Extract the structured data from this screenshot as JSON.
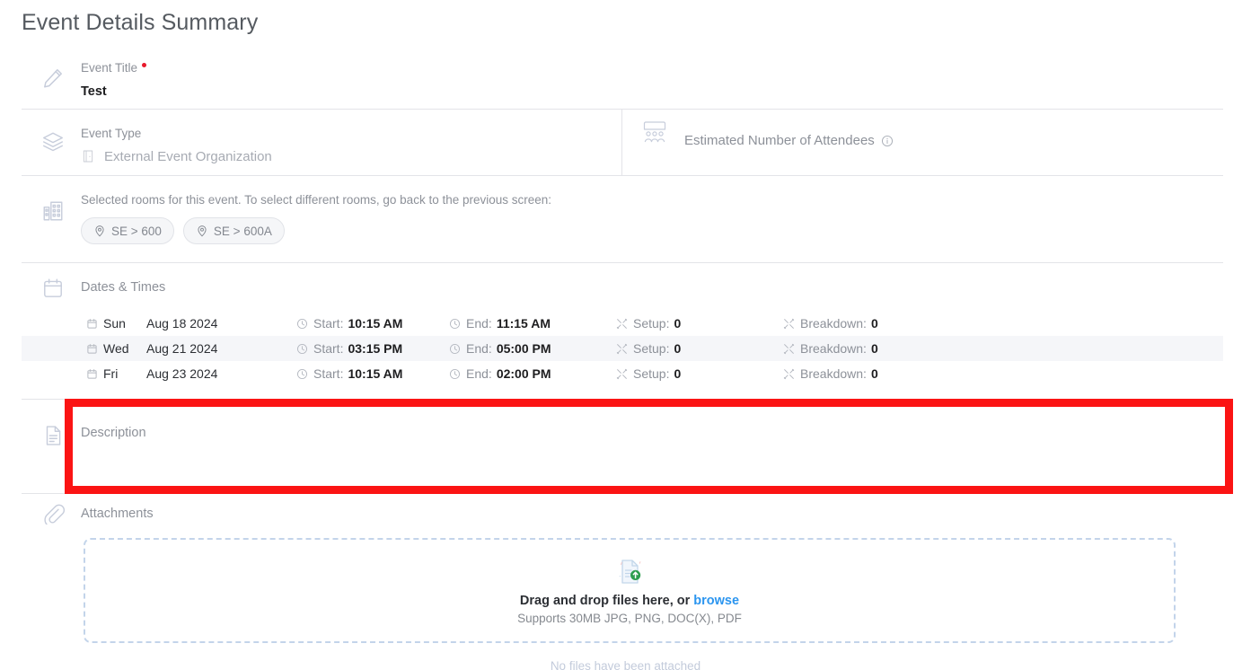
{
  "page": {
    "title": "Event Details Summary"
  },
  "event_title": {
    "label": "Event Title",
    "required": true,
    "value": "Test",
    "icon": "pencil-icon"
  },
  "event_type": {
    "label": "Event Type",
    "value": "External Event Organization",
    "icon": "layers-icon",
    "value_icon": "building-door-icon"
  },
  "attendees": {
    "label": "Estimated Number of Attendees",
    "icon": "audience-group-icon",
    "info_icon": "info-circle-icon",
    "value": ""
  },
  "rooms": {
    "instruction": "Selected rooms for this event. To select different rooms, go back to the previous screen:",
    "icon": "building-icon",
    "chips": [
      {
        "label": "SE > 600",
        "icon": "map-pin-icon"
      },
      {
        "label": "SE > 600A",
        "icon": "map-pin-icon"
      }
    ]
  },
  "dates_times": {
    "heading": "Dates & Times",
    "icon": "calendar-icon",
    "labels": {
      "start": "Start:",
      "end": "End:",
      "setup": "Setup:",
      "breakdown": "Breakdown:"
    },
    "rows": [
      {
        "day": "Sun",
        "date": "Aug 18 2024",
        "start": "10:15 AM",
        "end": "11:15 AM",
        "setup": "0",
        "breakdown": "0",
        "highlighted": false
      },
      {
        "day": "Wed",
        "date": "Aug 21 2024",
        "start": "03:15 PM",
        "end": "05:00 PM",
        "setup": "0",
        "breakdown": "0",
        "highlighted": true
      },
      {
        "day": "Fri",
        "date": "Aug 23 2024",
        "start": "10:15 AM",
        "end": "02:00 PM",
        "setup": "0",
        "breakdown": "0",
        "highlighted": false
      }
    ]
  },
  "description": {
    "label": "Description",
    "value": "",
    "icon": "document-icon",
    "highlight_color": "#fb1414"
  },
  "attachments": {
    "label": "Attachments",
    "icon": "paperclip-icon",
    "dropzone": {
      "icon": "file-upload-icon",
      "main_text": "Drag and drop files here, or ",
      "browse_label": "browse",
      "sub_text": "Supports 30MB JPG, PNG, DOC(X), PDF"
    },
    "empty_text": "No files have been attached"
  },
  "colors": {
    "accent_link": "#2b95ef",
    "required_red": "#e8192c",
    "highlight_red": "#fb1414",
    "divider": "#e3e4e8",
    "muted_text": "#8d9199"
  }
}
